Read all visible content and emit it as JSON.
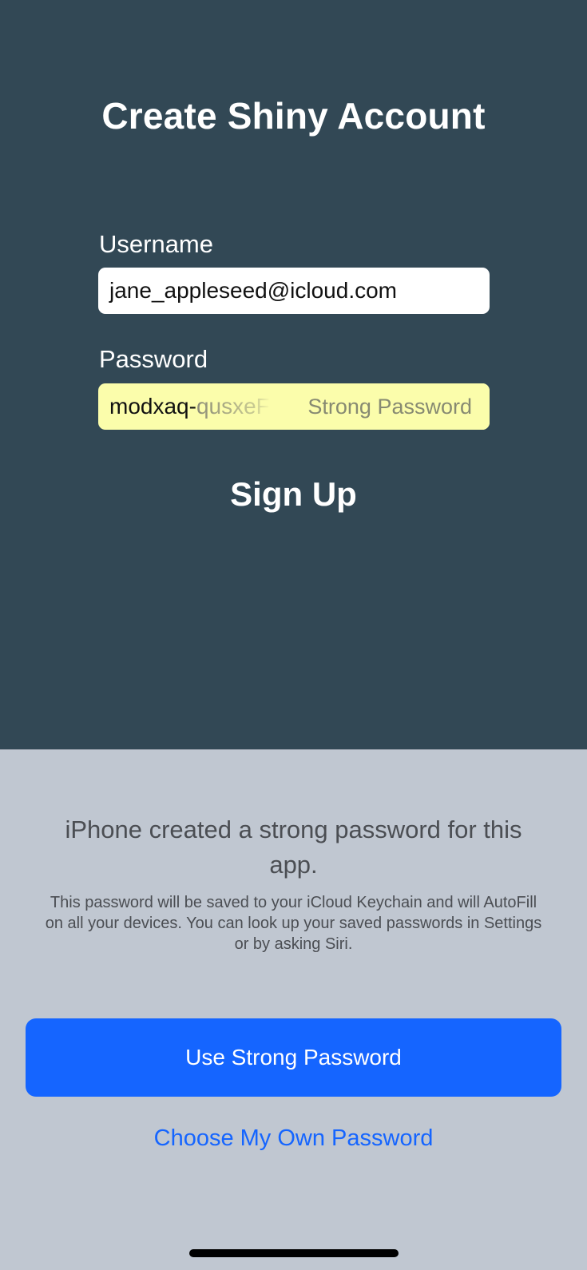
{
  "screen": {
    "title": "Create Shiny Account",
    "username_label": "Username",
    "username_value": "jane_appleseed@icloud.com",
    "password_label": "Password",
    "password_visible": "modxaq-",
    "password_faded": "qusxeF",
    "password_badge": "Strong Password",
    "signup_label": "Sign Up"
  },
  "sheet": {
    "heading": "iPhone created a strong password for this app.",
    "body": "This password will be saved to your iCloud Keychain and will AutoFill on all your devices. You can look up your saved passwords in Settings or by asking Siri.",
    "primary_label": "Use Strong Password",
    "secondary_label": "Choose My Own Password"
  },
  "colors": {
    "app_background": "#324855",
    "sheet_background": "#c0c7d1",
    "accent": "#1565ff",
    "autofill_highlight": "#fbfdab"
  }
}
